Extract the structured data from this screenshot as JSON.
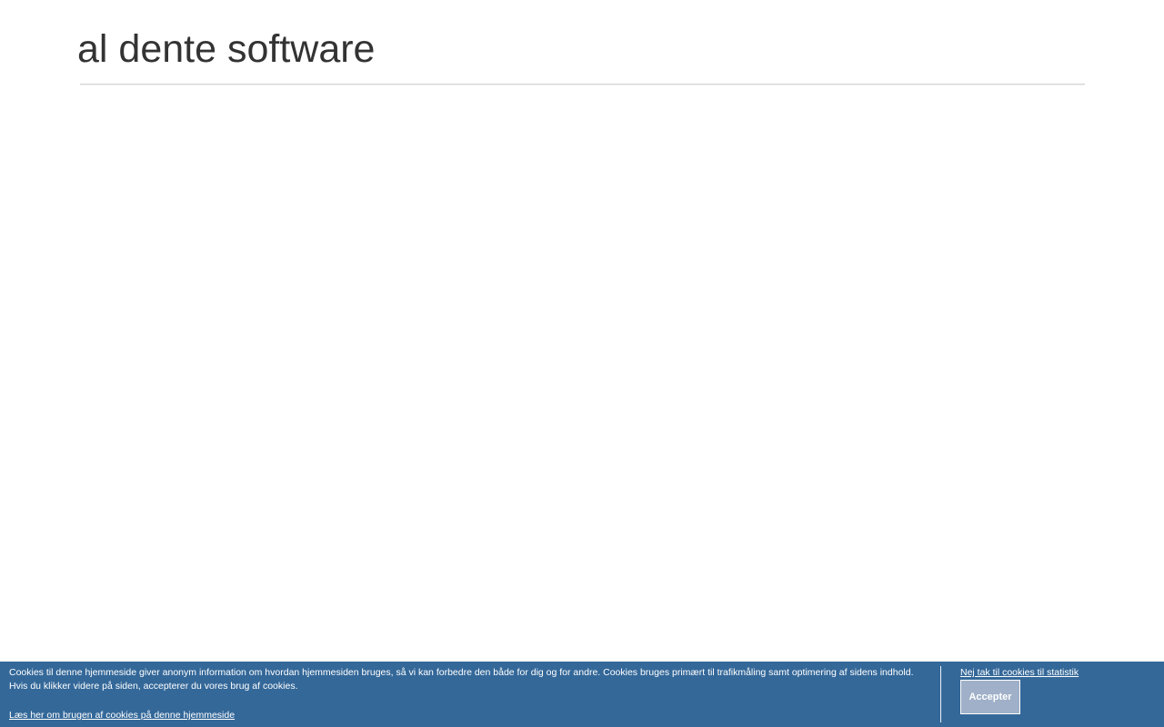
{
  "header": {
    "site_title": "al dente software"
  },
  "cookie_bar": {
    "message": "Cookies til denne hjemmeside giver anonym information om hvordan hjemmesiden bruges, så vi kan forbedre den både for dig og for andre. Cookies bruges primært til trafikmåling samt optimering af sidens indhold. Hvis du klikker videre på siden, accepterer du vores brug af cookies.",
    "read_more_link": "Læs her om brugen af cookies på denne hjemmeside",
    "decline_link": "Nej tak til cookies til statistik",
    "accept_button": "Accepter",
    "colors": {
      "background": "#346899",
      "accept_button_bg": "#9fb0c8",
      "text": "#ffffff"
    }
  }
}
